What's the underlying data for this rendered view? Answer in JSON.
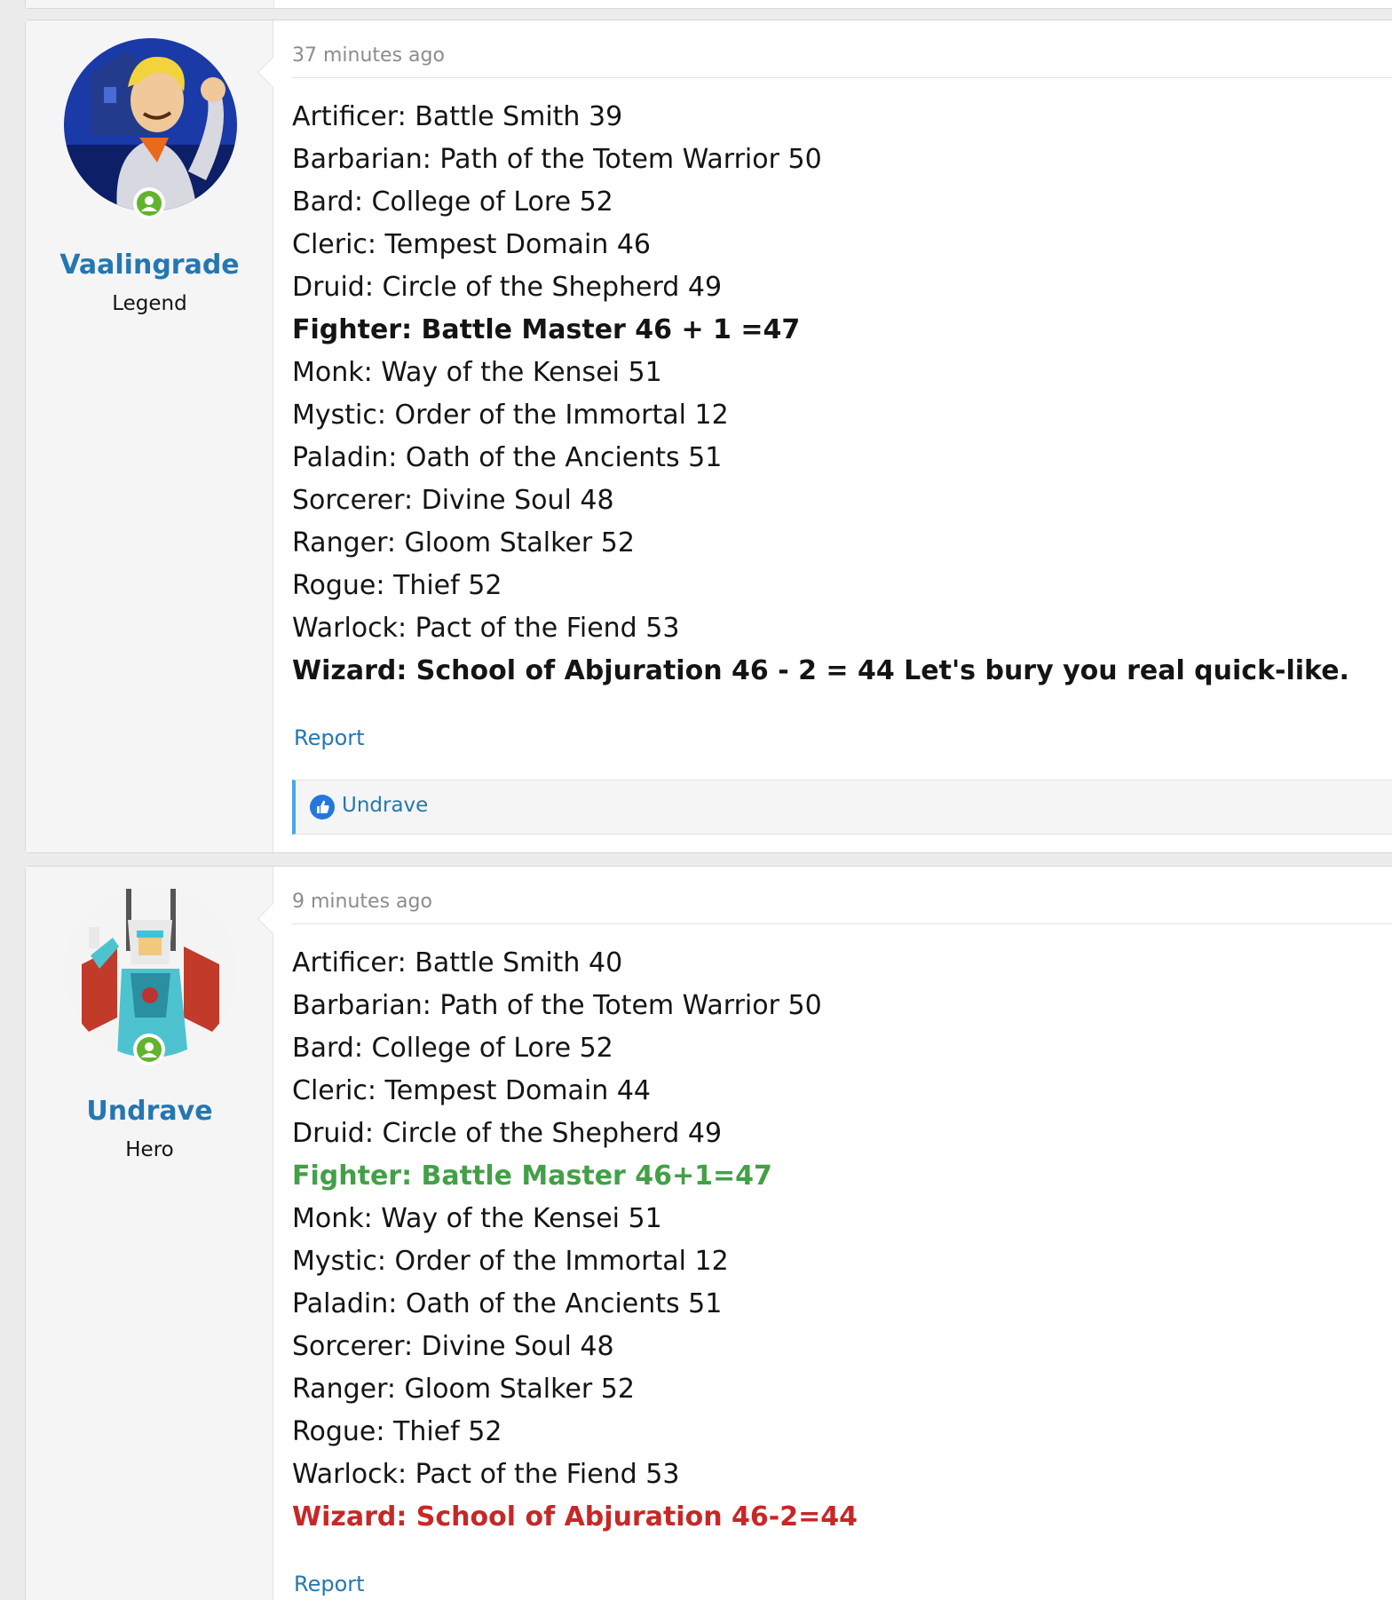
{
  "posts": [
    {
      "user": {
        "name": "Vaalingrade",
        "title": "Legend",
        "avatar": "cartoon-character-avatar",
        "online_icon": "user-online-icon"
      },
      "timestamp": "37 minutes ago",
      "lines": [
        "Artificer: Battle Smith 39",
        "Barbarian: Path of the Totem Warrior 50",
        "Bard: College of Lore 52",
        "Cleric: Tempest Domain 46",
        "Druid: Circle of the Shepherd 49",
        "Fighter: Battle Master 46 + 1 =47",
        "Monk: Way of the Kensei 51",
        "Mystic: Order of the Immortal 12",
        "Paladin: Oath of the Ancients 51",
        "Sorcerer: Divine Soul 48",
        "Ranger: Gloom Stalker 52",
        "Rogue: Thief 52",
        "Warlock: Pact of the Fiend 53",
        "Wizard: School of Abjuration 46 - 2 = 44 Let's bury you real quick-like."
      ],
      "report_label": "Report",
      "reaction_user": "Undrave",
      "reaction_icon": "thumbs-up-icon"
    },
    {
      "user": {
        "name": "Undrave",
        "title": "Hero",
        "avatar": "robot-character-avatar",
        "online_icon": "user-online-icon"
      },
      "timestamp": "9 minutes ago",
      "lines": [
        "Artificer: Battle Smith 40",
        "Barbarian: Path of the Totem Warrior 50",
        "Bard: College of Lore 52",
        "Cleric: Tempest Domain 44",
        "Druid: Circle of the Shepherd 49",
        "Fighter: Battle Master 46+1=47",
        "Monk: Way of the Kensei 51",
        "Mystic: Order of the Immortal 12",
        "Paladin: Oath of the Ancients 51",
        "Sorcerer: Divine Soul 48",
        "Ranger: Gloom Stalker 52",
        "Rogue: Thief 52",
        "Warlock: Pact of the Fiend 53",
        "Wizard: School of Abjuration 46-2=44"
      ],
      "report_label": "Report"
    }
  ],
  "colors": {
    "link": "#2577b1",
    "green_highlight": "#43a047",
    "red_highlight": "#c62828",
    "online": "#63b32e"
  }
}
